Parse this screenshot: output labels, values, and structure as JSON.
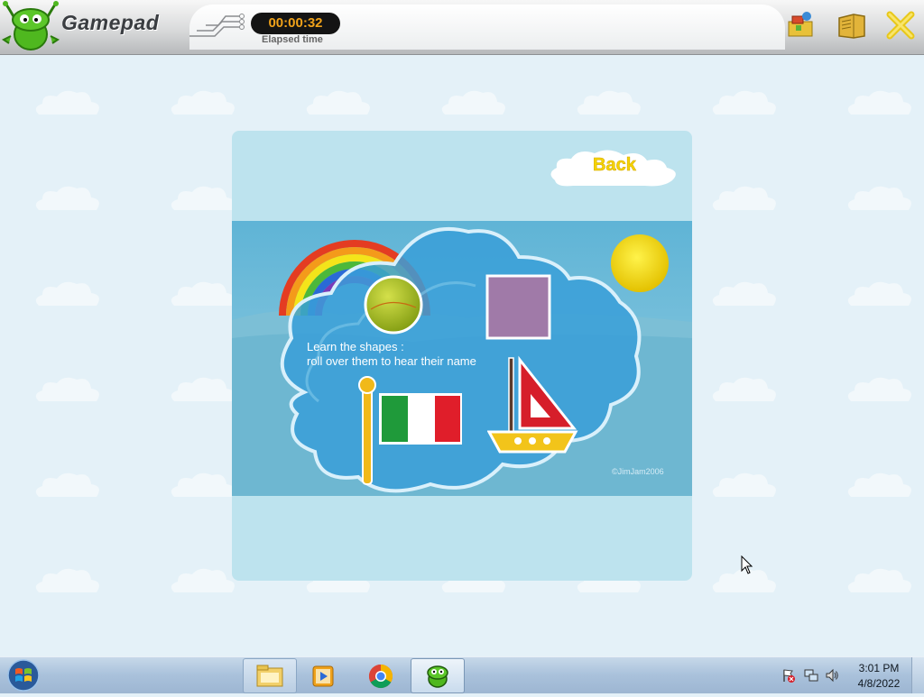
{
  "app": {
    "title": "Gamepad",
    "timer": "00:00:32",
    "timer_label": "Elapsed time"
  },
  "toolbar": {
    "icons": [
      "games-icon",
      "book-icon",
      "close-icon"
    ]
  },
  "game": {
    "back_label": "Back",
    "instructions_line1": "Learn the shapes :",
    "instructions_line2": "roll over them to hear their name",
    "copyright": "©JimJam2006",
    "shapes": [
      "circle",
      "square",
      "rectangle-flag",
      "triangle-boat"
    ]
  },
  "taskbar": {
    "pinned": [
      "file-explorer-icon",
      "media-player-icon",
      "chrome-icon",
      "gamepad-icon"
    ],
    "active": "gamepad-icon",
    "time": "3:01 PM",
    "date": "4/8/2022"
  },
  "colors": {
    "timer_text": "#f0a21a",
    "back_text": "#f5d400",
    "panel_bg": "#bde3ee",
    "sky": "#68b9d9"
  }
}
